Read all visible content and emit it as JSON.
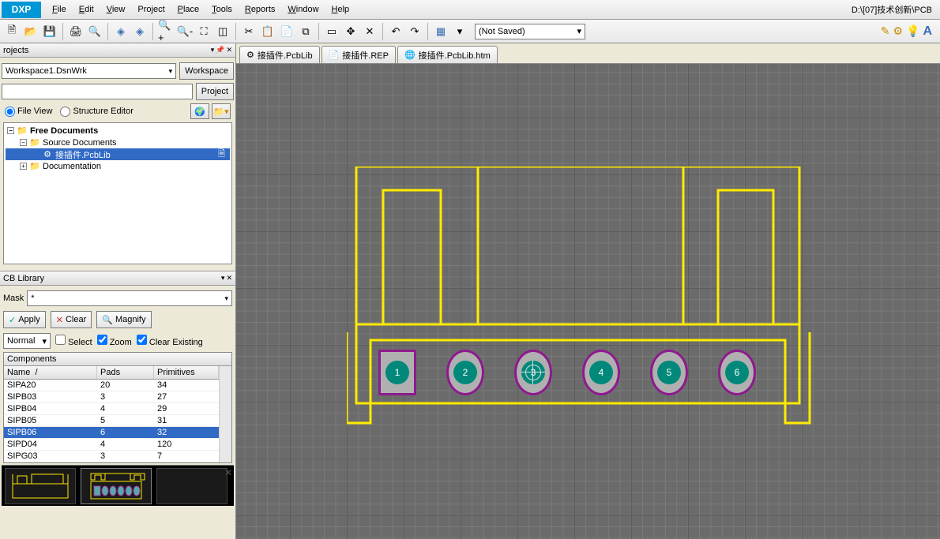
{
  "menubar": {
    "dxp": "DXP",
    "items": [
      "File",
      "Edit",
      "View",
      "Project",
      "Place",
      "Tools",
      "Reports",
      "Window",
      "Help"
    ],
    "path": "D:\\[07]技术创新\\PCB"
  },
  "toolbar": {
    "save_combo": "(Not Saved)"
  },
  "projects": {
    "title": "rojects",
    "workspace": "Workspace1.DsnWrk",
    "btn_workspace": "Workspace",
    "btn_project": "Project",
    "radio_file": "File View",
    "radio_structure": "Structure Editor",
    "tree": {
      "free_docs": "Free Documents",
      "source_docs": "Source Documents",
      "pcblib": "接插件.PcbLib",
      "documentation": "Documentation"
    }
  },
  "library": {
    "title": "CB Library",
    "mask_label": "Mask",
    "mask_value": "*",
    "btn_apply": "Apply",
    "btn_clear": "Clear",
    "btn_magnify": "Magnify",
    "normal": "Normal",
    "chk_select": "Select",
    "chk_zoom": "Zoom",
    "chk_clear": "Clear Existing",
    "grid_title": "Components",
    "col_name": "Name",
    "col_pads": "Pads",
    "col_prim": "Primitives",
    "rows": [
      {
        "n": "SIPA20",
        "p": "20",
        "r": "34"
      },
      {
        "n": "SIPB03",
        "p": "3",
        "r": "27"
      },
      {
        "n": "SIPB04",
        "p": "4",
        "r": "29"
      },
      {
        "n": "SIPB05",
        "p": "5",
        "r": "31"
      },
      {
        "n": "SIPB06",
        "p": "6",
        "r": "32"
      },
      {
        "n": "SIPD04",
        "p": "4",
        "r": "120"
      },
      {
        "n": "SIPG03",
        "p": "3",
        "r": "7"
      }
    ],
    "selected_index": 4
  },
  "tabs": [
    {
      "icon": "⚙",
      "label": "接插件.PcbLib"
    },
    {
      "icon": "📄",
      "label": "接插件.REP"
    },
    {
      "icon": "🌐",
      "label": "接插件.PcbLib.htm"
    }
  ],
  "pads": [
    "1",
    "2",
    "3",
    "4",
    "5",
    "6"
  ]
}
